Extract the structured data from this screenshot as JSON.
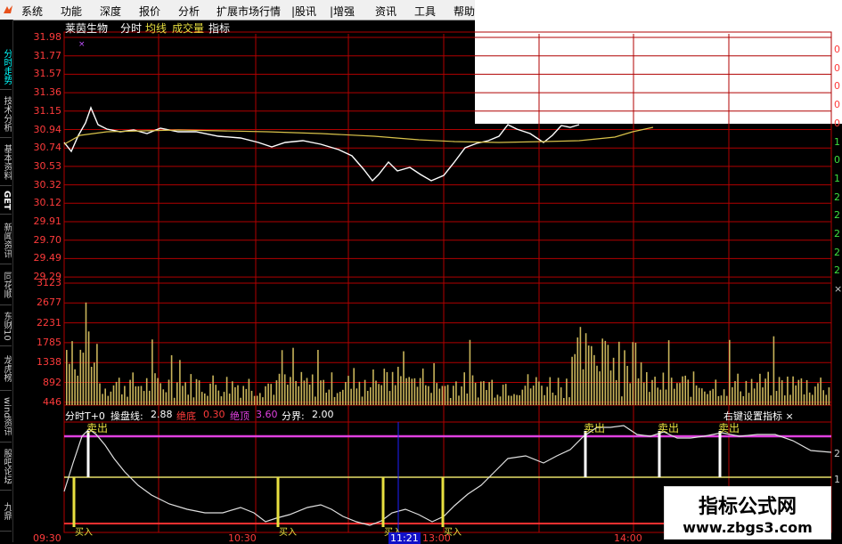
{
  "menu": [
    "系统",
    "功能",
    "深度",
    "报价",
    "分析",
    "扩展市场行情",
    "|股讯",
    "|增强",
    "资讯",
    "工具",
    "帮助"
  ],
  "sidebar_tabs": [
    {
      "label": "分时走势",
      "active": true
    },
    {
      "label": "技术分析",
      "active": false
    },
    {
      "label": "基本资料",
      "active": false
    },
    {
      "label": "GET",
      "active": false
    },
    {
      "label": "新闻资讯",
      "active": false
    },
    {
      "label": "同花顺",
      "active": false
    },
    {
      "label": "东财10",
      "active": false
    },
    {
      "label": "龙虎榜",
      "active": false
    },
    {
      "label": "wind资讯",
      "active": false
    },
    {
      "label": "股吧论坛",
      "active": false
    },
    {
      "label": "九鼎",
      "active": false
    }
  ],
  "header": {
    "stock_name": "莱茵生物",
    "tab_intraday": "分时",
    "tab_avg": "均线",
    "tab_volume": "成交量",
    "tab_indicator": "指标"
  },
  "price_axis": [
    "31.98",
    "31.77",
    "31.57",
    "31.36",
    "31.15",
    "30.94",
    "30.74",
    "30.53",
    "30.32",
    "30.12",
    "29.91",
    "29.70",
    "29.49",
    "29.29"
  ],
  "volume_axis": [
    "3123",
    "2677",
    "2231",
    "1785",
    "1338",
    "892",
    "446"
  ],
  "right_axis_digits": [
    "0",
    "0",
    "0",
    "0",
    "0",
    "1",
    "0",
    "1",
    "2",
    "2",
    "2",
    "2",
    "2",
    "×"
  ],
  "indicator": {
    "name": "分时T+0",
    "line_label": "操盘线:",
    "line_value": "2.88",
    "bottom_label": "绝底",
    "bottom_value": "0.30",
    "top_label": "绝顶",
    "top_value": "3.60",
    "split_label": "分界:",
    "split_value": "2.00",
    "settings_label": "右键设置指标 ×",
    "sell_label": "卖出",
    "buy_label": "买入",
    "right_ticks": [
      "2",
      "1"
    ]
  },
  "time_axis": [
    "09:30",
    "10:30",
    "11:21",
    "13:00",
    "14:00"
  ],
  "watermark": {
    "title": "指标公式网",
    "url": "www.zbgs3.com"
  },
  "colors": {
    "grid": "#b00000",
    "price_line": "#ffffff",
    "avg_line": "#d8c24a",
    "volume_bar": "#c8b45a",
    "top_line": "#e040e0",
    "split_line": "#e8e06a",
    "bottom_line": "#ff3030"
  }
}
